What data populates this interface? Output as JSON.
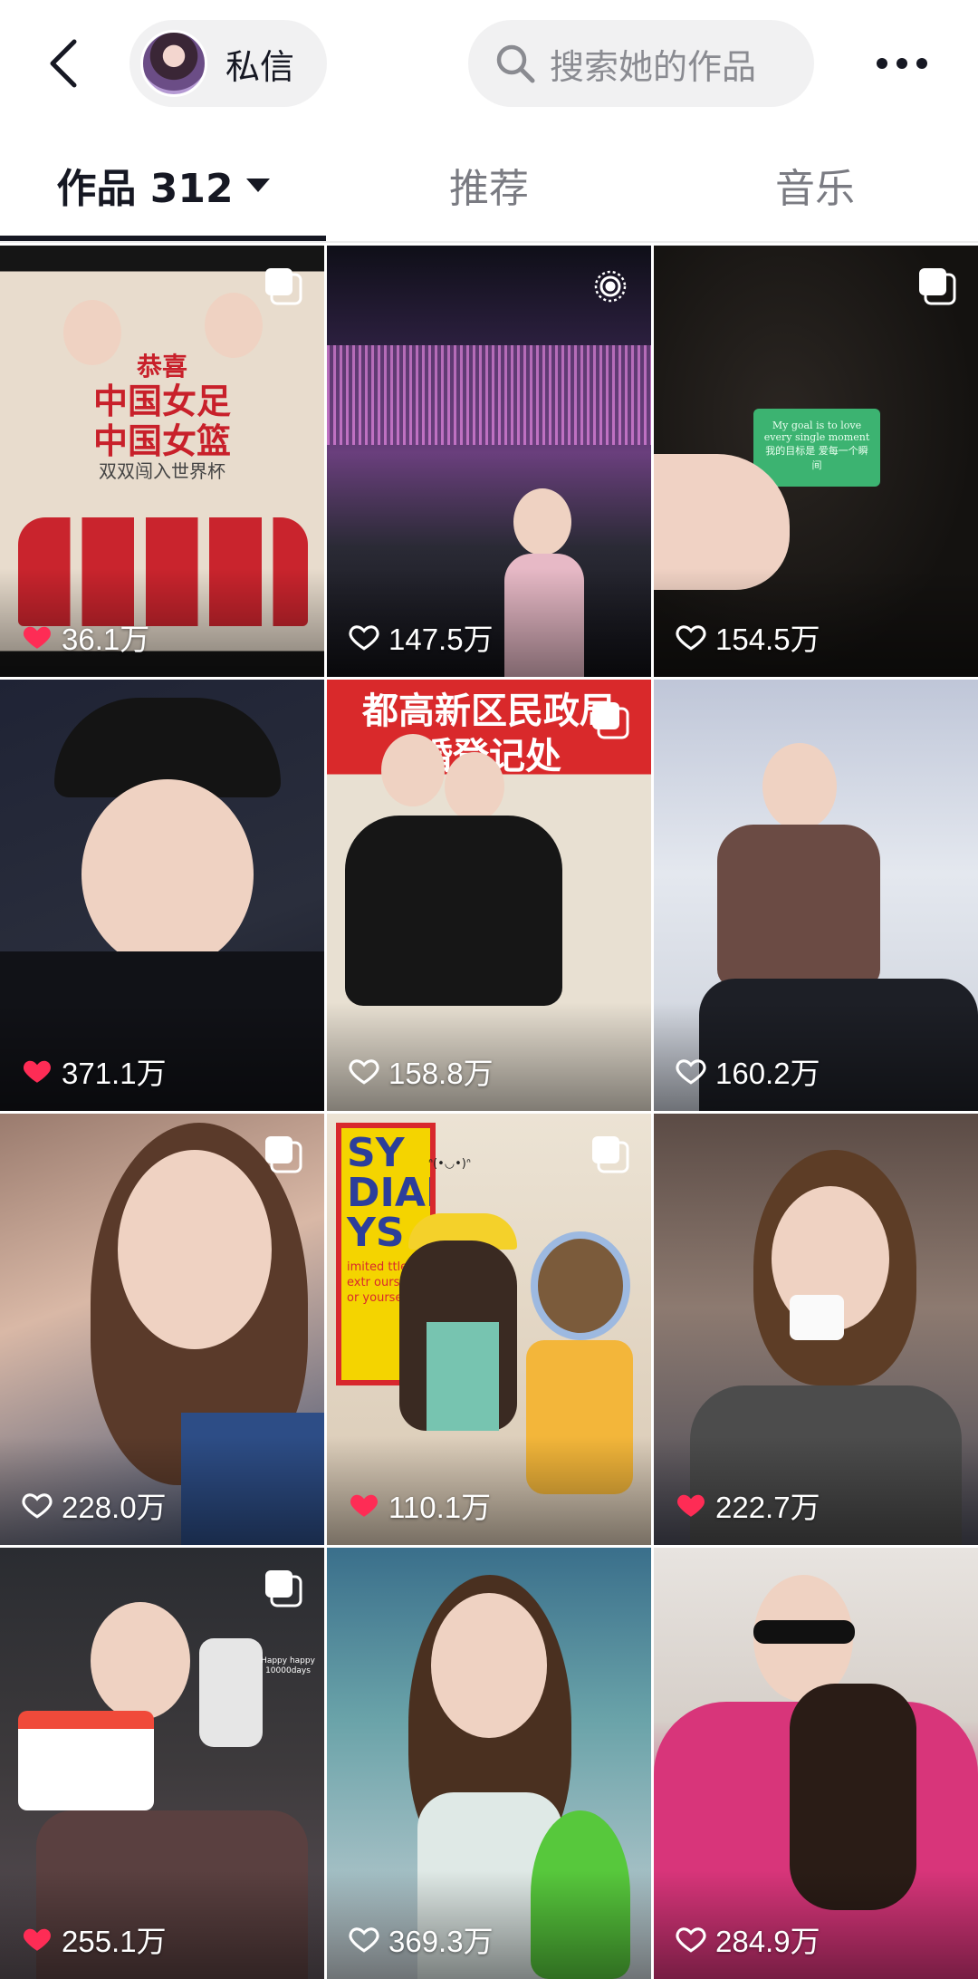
{
  "header": {
    "back_icon": "back-arrow-icon",
    "dm_label": "私信",
    "search_placeholder": "搜索她的作品",
    "more_icon": "more-dots-icon"
  },
  "tabs": [
    {
      "label": "作品 312",
      "active": true
    },
    {
      "label": "推荐",
      "active": false
    },
    {
      "label": "音乐",
      "active": false
    }
  ],
  "videos": [
    {
      "likes": "36.1万",
      "liked": true,
      "badge": "multi-image-icon"
    },
    {
      "likes": "147.5万",
      "liked": false,
      "badge": "live-photo-icon"
    },
    {
      "likes": "154.5万",
      "liked": false,
      "badge": "multi-image-icon"
    },
    {
      "likes": "371.1万",
      "liked": true,
      "badge": ""
    },
    {
      "likes": "158.8万",
      "liked": false,
      "badge": "multi-image-icon"
    },
    {
      "likes": "160.2万",
      "liked": false,
      "badge": ""
    },
    {
      "likes": "228.0万",
      "liked": false,
      "badge": "multi-image-icon"
    },
    {
      "likes": "110.1万",
      "liked": true,
      "badge": "multi-image-icon"
    },
    {
      "likes": "222.7万",
      "liked": true,
      "badge": ""
    },
    {
      "likes": "255.1万",
      "liked": true,
      "badge": "multi-image-icon"
    },
    {
      "likes": "369.3万",
      "liked": false,
      "badge": ""
    },
    {
      "likes": "284.9万",
      "liked": false,
      "badge": ""
    }
  ],
  "poster": {
    "line1": "恭喜",
    "line2": "中国女足",
    "line3": "中国女篮",
    "line4": "双双闯入世界杯"
  },
  "card_text": "My goal is to love every single moment 我的目标是 爱每一个瞬间",
  "wall_text": {
    "line1": "都高新区民政局",
    "line2": "婚登记处"
  },
  "book_text": {
    "big": "SY DIAN YS",
    "small": "imited ttle extr ourself. or yourself."
  },
  "sticker_text": "ᐢ(•◡•)ᐢ",
  "mirror_note": "Happy happy 10000days",
  "colors": {
    "like_red": "#fe2c55",
    "text_primary": "#161823",
    "text_secondary": "#7a7b82",
    "pill_bg": "#f1f1f2"
  }
}
